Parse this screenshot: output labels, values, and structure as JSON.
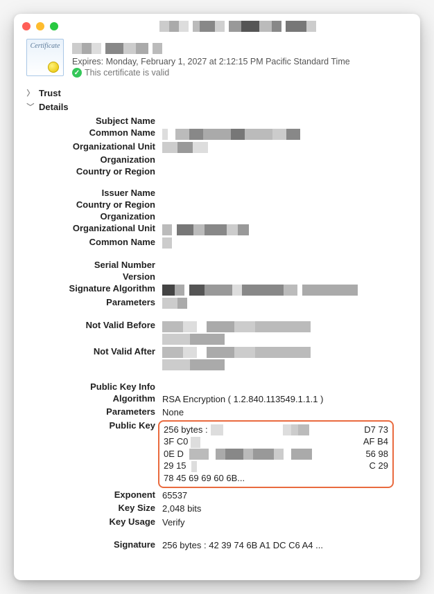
{
  "header": {
    "certificate_word": "Certificate",
    "expires_label": "Expires:",
    "expires_value": "Monday, February 1, 2027 at 2:12:15 PM Pacific Standard Time",
    "valid_text": "This certificate is valid"
  },
  "sections": {
    "trust": "Trust",
    "details": "Details"
  },
  "subject": {
    "heading": "Subject Name",
    "common_name": "Common Name",
    "org_unit": "Organizational Unit",
    "organization": "Organization",
    "country": "Country or Region"
  },
  "issuer": {
    "heading": "Issuer Name",
    "country": "Country or Region",
    "organization": "Organization",
    "org_unit": "Organizational Unit",
    "common_name": "Common Name"
  },
  "cert": {
    "serial": "Serial Number",
    "version": "Version",
    "sig_algo": "Signature Algorithm",
    "parameters": "Parameters"
  },
  "validity": {
    "not_before": "Not Valid Before",
    "not_after": "Not Valid After"
  },
  "pki": {
    "heading": "Public Key Info",
    "algorithm_label": "Algorithm",
    "algorithm_value": "RSA Encryption ( 1.2.840.113549.1.1.1 )",
    "parameters_label": "Parameters",
    "parameters_value": "None",
    "public_key_label": "Public Key",
    "public_key": {
      "prefix": "256 bytes :",
      "line1_right": "D7 73",
      "line2_left": "3F C0",
      "line2_right": "AF B4",
      "line3_left": "0E D",
      "line3_right": "56 98",
      "line4_left": "29 15",
      "line4_right": "C 29",
      "line5": "78 45 69 69 60 6B..."
    },
    "exponent_label": "Exponent",
    "exponent_value": "65537",
    "key_size_label": "Key Size",
    "key_size_value": "2,048 bits",
    "key_usage_label": "Key Usage",
    "key_usage_value": "Verify",
    "signature_label": "Signature",
    "signature_value": "256 bytes : 42 39 74 6B A1 DC C6 A4 ..."
  }
}
